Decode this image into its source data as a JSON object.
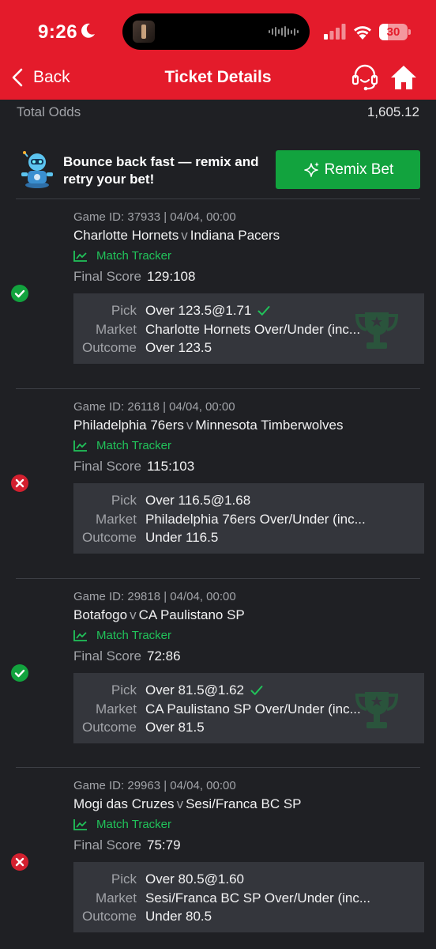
{
  "status_bar": {
    "time": "9:26",
    "battery": "30",
    "battery_level": 0.3
  },
  "header": {
    "back_label": "Back",
    "title": "Ticket Details"
  },
  "total_odds": {
    "label": "Total Odds",
    "value": "1,605.12"
  },
  "promo": {
    "text": "Bounce back fast — remix and retry your bet!",
    "button_label": "Remix Bet"
  },
  "labels": {
    "match_tracker": "Match Tracker",
    "final_score": "Final Score",
    "pick": "Pick",
    "market": "Market",
    "outcome": "Outcome",
    "vs": "v"
  },
  "bets": [
    {
      "status": "won",
      "game_info": "Game ID: 37933 | 04/04, 00:00",
      "home": "Charlotte Hornets",
      "away": "Indiana Pacers",
      "final_score": "129:108",
      "pick": "Over 123.5@1.71",
      "market": "Charlotte Hornets Over/Under (inc...",
      "outcome": "Over 123.5"
    },
    {
      "status": "lost",
      "game_info": "Game ID: 26118 | 04/04, 00:00",
      "home": "Philadelphia 76ers",
      "away": "Minnesota Timberwolves",
      "final_score": "115:103",
      "pick": "Over 116.5@1.68",
      "market": "Philadelphia 76ers Over/Under (inc...",
      "outcome": "Under 116.5"
    },
    {
      "status": "won",
      "game_info": "Game ID: 29818 | 04/04, 00:00",
      "home": "Botafogo",
      "away": "CA Paulistano SP",
      "final_score": "72:86",
      "pick": "Over 81.5@1.62",
      "market": "CA Paulistano SP Over/Under (inc...",
      "outcome": "Over 81.5"
    },
    {
      "status": "lost",
      "game_info": "Game ID: 29963 | 04/04, 00:00",
      "home": "Mogi das Cruzes",
      "away": "Sesi/Franca BC SP",
      "final_score": "75:79",
      "pick": "Over 80.5@1.60",
      "market": "Sesi/Franca BC SP Over/Under (inc...",
      "outcome": "Under 80.5"
    }
  ],
  "colors": {
    "header_red": "#e41b2b",
    "background": "#1f2024",
    "win_green": "#12a33e",
    "loss_red": "#d3202f",
    "tracker_green": "#21c25a"
  }
}
